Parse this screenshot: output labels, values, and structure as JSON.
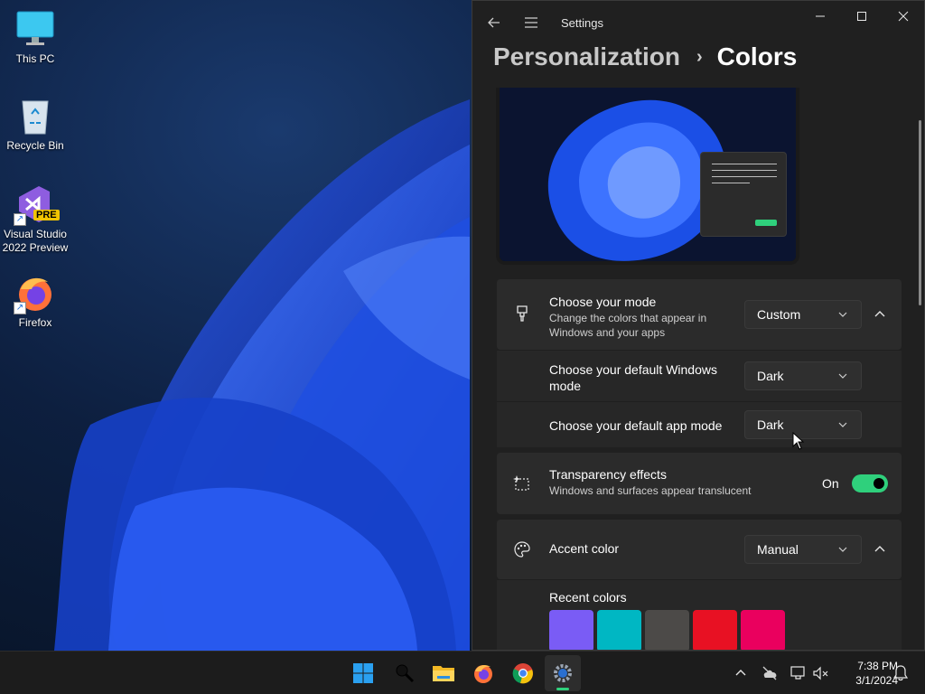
{
  "desktop": {
    "icons": [
      {
        "label": "This PC"
      },
      {
        "label": "Recycle Bin"
      },
      {
        "label": "Visual Studio\n2022 Preview",
        "badge": "PRE"
      },
      {
        "label": "Firefox"
      }
    ]
  },
  "window": {
    "title": "Settings",
    "breadcrumb": {
      "parent": "Personalization",
      "separator": "›",
      "current": "Colors"
    }
  },
  "settings": {
    "mode": {
      "title": "Choose your mode",
      "description": "Change the colors that appear in Windows and your apps",
      "value": "Custom",
      "icon": "brush-icon"
    },
    "windows_mode": {
      "title": "Choose your default Windows mode",
      "value": "Dark"
    },
    "app_mode": {
      "title": "Choose your default app mode",
      "value": "Dark"
    },
    "transparency": {
      "title": "Transparency effects",
      "description": "Windows and surfaces appear translucent",
      "state_label": "On",
      "enabled": true,
      "icon": "transparency-icon"
    },
    "accent": {
      "title": "Accent color",
      "value": "Manual",
      "icon": "palette-icon"
    },
    "recent_colors": {
      "title": "Recent colors",
      "colors": [
        "#7a5cf5",
        "#00b7c3",
        "#4c4a48",
        "#e81123",
        "#ea005e"
      ]
    }
  },
  "accent_color": "#2fd07c",
  "taskbar": {
    "apps": [
      "start-icon",
      "search-icon",
      "file-explorer-icon",
      "firefox-icon",
      "chrome-icon",
      "settings-icon"
    ],
    "clock": {
      "time": "7:38 PM",
      "date": "3/1/2024"
    }
  }
}
